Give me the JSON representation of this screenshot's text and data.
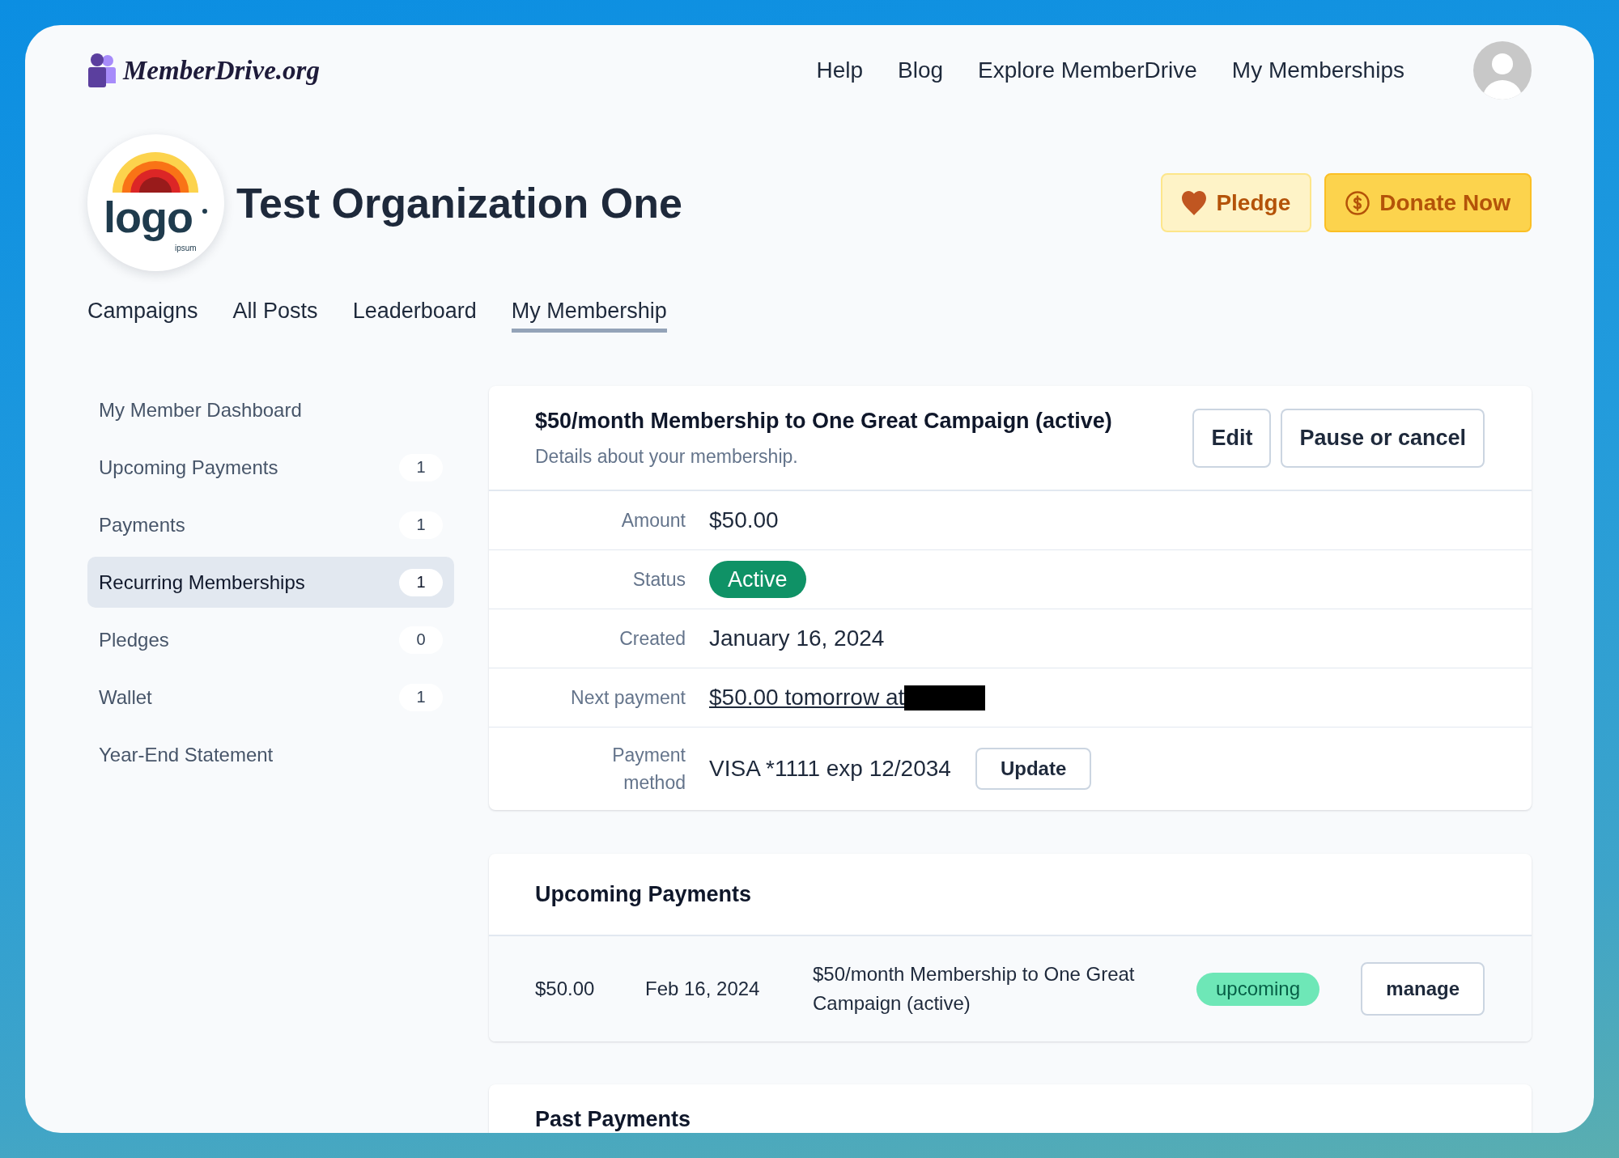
{
  "header": {
    "brand": "MemberDrive.org",
    "nav": [
      "Help",
      "Blog",
      "Explore MemberDrive",
      "My Memberships"
    ]
  },
  "organization": {
    "name": "Test Organization One",
    "logo_text": "logo",
    "logo_subtext": "ipsum",
    "actions": [
      {
        "label": "Pledge",
        "kind": "pledge"
      },
      {
        "label": "Donate Now",
        "kind": "donate"
      }
    ]
  },
  "tabs": [
    {
      "label": "Campaigns",
      "selected": false
    },
    {
      "label": "All Posts",
      "selected": false
    },
    {
      "label": "Leaderboard",
      "selected": false
    },
    {
      "label": "My Membership",
      "selected": true
    }
  ],
  "sidebar": {
    "items": [
      {
        "label": "My Member Dashboard",
        "selected": false
      },
      {
        "label": "Upcoming Payments",
        "count": "1",
        "selected": false
      },
      {
        "label": "Payments",
        "count": "1",
        "selected": false
      },
      {
        "label": "Recurring Memberships",
        "count": "1",
        "selected": true
      },
      {
        "label": "Pledges",
        "count": "0",
        "selected": false
      },
      {
        "label": "Wallet",
        "count": "1",
        "selected": false
      },
      {
        "label": "Year-End Statement",
        "selected": false
      }
    ]
  },
  "membership": {
    "title": "$50/month Membership to One Great Campaign (active)",
    "subtitle": "Details about your membership.",
    "actions": [
      "Edit",
      "Pause or cancel"
    ],
    "fields": [
      {
        "label": "Amount",
        "kind": "text",
        "value": "$50.00"
      },
      {
        "label": "Status",
        "kind": "badge",
        "value": "Active"
      },
      {
        "label": "Created",
        "kind": "text",
        "value": "January 16, 2024"
      },
      {
        "label": "Next payment",
        "kind": "link",
        "value": "$50.00 tomorrow at",
        "redacted": true
      },
      {
        "label": "Payment method",
        "kind": "card",
        "value": "VISA *1111 exp 12/2034",
        "action": "Update"
      }
    ]
  },
  "upcoming_payments": {
    "title": "Upcoming Payments",
    "rows": [
      {
        "amount": "$50.00",
        "date": "Feb 16, 2024",
        "description": "$50/month Membership to One Great Campaign (active)",
        "status": "upcoming",
        "action": "manage"
      }
    ]
  },
  "past_payments": {
    "title": "Past Payments"
  }
}
